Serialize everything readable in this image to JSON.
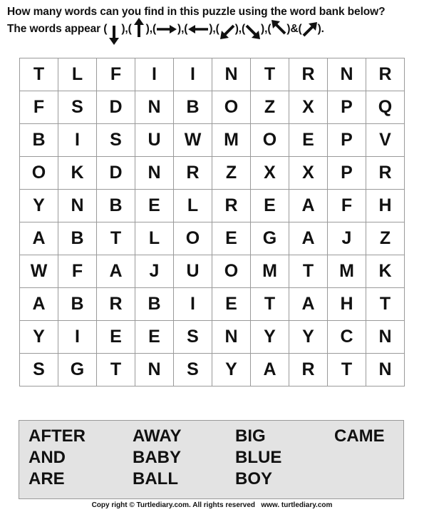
{
  "instructions": {
    "line1": "How many words can you find in this puzzle using the word bank below?",
    "line2_prefix": "The words appear",
    "directions": [
      {
        "icon": "arrow-down-icon",
        "glyph": "↓"
      },
      {
        "icon": "arrow-up-icon",
        "glyph": "↑"
      },
      {
        "icon": "arrow-right-icon",
        "glyph": "→"
      },
      {
        "icon": "arrow-left-icon",
        "glyph": "←"
      },
      {
        "icon": "arrow-down-left-icon",
        "glyph": "↙"
      },
      {
        "icon": "arrow-down-right-icon",
        "glyph": "↘"
      },
      {
        "icon": "arrow-up-left-icon",
        "glyph": "↖"
      },
      {
        "icon": "arrow-up-right-icon",
        "glyph": "↗"
      }
    ],
    "separator": ",",
    "ampersand": "&",
    "end": "."
  },
  "grid": [
    [
      "T",
      "L",
      "F",
      "I",
      "I",
      "N",
      "T",
      "R",
      "N",
      "R"
    ],
    [
      "F",
      "S",
      "D",
      "N",
      "B",
      "O",
      "Z",
      "X",
      "P",
      "Q"
    ],
    [
      "B",
      "I",
      "S",
      "U",
      "W",
      "M",
      "O",
      "E",
      "P",
      "V"
    ],
    [
      "O",
      "K",
      "D",
      "N",
      "R",
      "Z",
      "X",
      "X",
      "P",
      "R"
    ],
    [
      "Y",
      "N",
      "B",
      "E",
      "L",
      "R",
      "E",
      "A",
      "F",
      "H"
    ],
    [
      "A",
      "B",
      "T",
      "L",
      "O",
      "E",
      "G",
      "A",
      "J",
      "Z"
    ],
    [
      "W",
      "F",
      "A",
      "J",
      "U",
      "O",
      "M",
      "T",
      "M",
      "K"
    ],
    [
      "A",
      "B",
      "R",
      "B",
      "I",
      "E",
      "T",
      "A",
      "H",
      "T"
    ],
    [
      "Y",
      "I",
      "E",
      "E",
      "S",
      "N",
      "Y",
      "Y",
      "C",
      "N"
    ],
    [
      "S",
      "G",
      "T",
      "N",
      "S",
      "Y",
      "A",
      "R",
      "T",
      "N"
    ]
  ],
  "word_bank": {
    "columns": [
      [
        "AFTER",
        "AND",
        "ARE"
      ],
      [
        "AWAY",
        "BABY",
        "BALL"
      ],
      [
        "BIG",
        "BLUE",
        "BOY"
      ],
      [
        "CAME"
      ]
    ],
    "background": "#e3e3e3"
  },
  "footer": {
    "copyright": "Copy right © Turtlediary.com. All rights reserved",
    "site": "www. turtlediary.com"
  }
}
